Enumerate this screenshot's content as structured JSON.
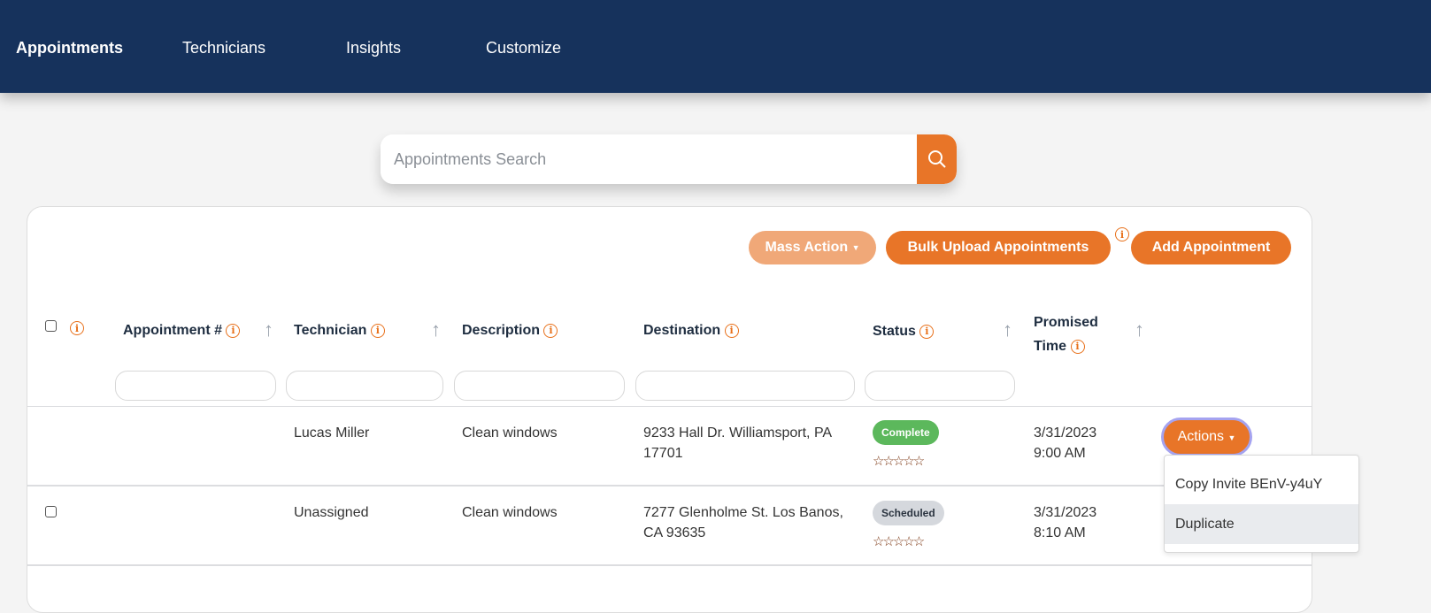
{
  "nav": {
    "items": [
      {
        "label": "Appointments",
        "active": true
      },
      {
        "label": "Technicians"
      },
      {
        "label": "Insights"
      },
      {
        "label": "Customize"
      }
    ]
  },
  "search": {
    "placeholder": "Appointments Search",
    "icon": "search-icon"
  },
  "toolbar": {
    "mass_action": "Mass Action",
    "bulk_upload": "Bulk Upload Appointments",
    "add": "Add Appointment"
  },
  "columns": [
    "Appointment #",
    "Technician",
    "Description",
    "Destination",
    "Status",
    "Promised Time"
  ],
  "colors": {
    "nav": "#16325c",
    "accent": "#e87528",
    "complete": "#5cb85c",
    "scheduled": "#d5d8dd"
  },
  "rows": [
    {
      "appointment": "",
      "technician": "Lucas Miller",
      "description": "Clean windows",
      "destination": "9233 Hall Dr. Williamsport, PA 17701",
      "status": "Complete",
      "rating": 0,
      "time": "3/31/2023 9:00 AM"
    },
    {
      "appointment": "",
      "technician": "Unassigned",
      "description": "Clean windows",
      "destination": "7277 Glenholme St. Los Banos, CA 93635",
      "status": "Scheduled",
      "rating": 0,
      "time": "3/31/2023 8:10 AM"
    }
  ],
  "actions": {
    "label": "Actions",
    "menu": [
      "Copy Invite BEnV-y4uY",
      "Duplicate"
    ]
  },
  "stars": "☆☆☆☆☆"
}
